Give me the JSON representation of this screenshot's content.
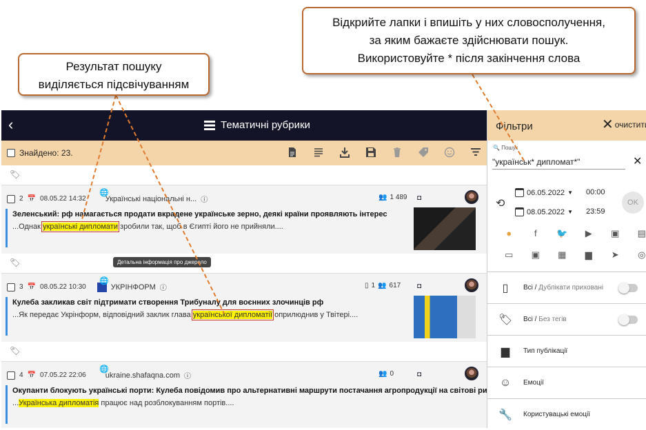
{
  "callouts": {
    "right": [
      "Відкрийте лапки і впишіть у них словосполучення,",
      "за яким бажаєте здійснювати пошук.",
      "Використовуйте * після закінчення слова"
    ],
    "left": [
      "Результат пошуку",
      "виділяється підсвічуванням"
    ]
  },
  "header": {
    "back_icon": "chevron-left-icon",
    "title": "Тематичні рубрики",
    "title_icon": "list-icon"
  },
  "toolbar": {
    "found": "Знайдено: 23.",
    "tools": [
      "document-icon",
      "lines-icon",
      "download-icon",
      "save-icon",
      "delete-icon",
      "tag-icon",
      "emoji-icon",
      "filter-icon"
    ]
  },
  "items": [
    {
      "num": "2",
      "date": "08.05.22 14:32",
      "source": "Українські національні н...",
      "stat_people": "1 489",
      "stat_dup": "",
      "headline": "Зеленський: рф намагається продати вкрадене українське зерно, деякі країни проявляють інтерес",
      "snip_pre": "...Однак ",
      "snip_hl": "українські дипломати",
      "snip_post": " зробили так, щоб в Єгипті його не прийняли....",
      "thumb": "zelensky"
    },
    {
      "num": "3",
      "date": "08.05.22 10:30",
      "source": "УКРІНФОРМ",
      "stat_people": "617",
      "stat_dup": "1",
      "headline": "Кулеба закликав світ підтримати створення Трибуналу для воєнних злочинців рф",
      "snip_pre": "...Як передає Укрінформ, відповідний заклик глава ",
      "snip_hl": "української дипломатії",
      "snip_post": " оприлюднив у Твітері....",
      "thumb": "kuleba"
    },
    {
      "num": "4",
      "date": "07.05.22 22:06",
      "source": "ukraine.shafaqna.com",
      "stat_people": "0",
      "stat_dup": "",
      "headline": "Окупанти блокують українські порти: Кулеба повідомив про альтернативні маршрути постачання агропродукції на світові ринки",
      "snip_pre": "...",
      "snip_hl": "Українська дипломатія",
      "snip_post": " працює над розблокуванням портів....",
      "thumb": ""
    }
  ],
  "tooltip": "Детальна інформація про джерело",
  "panel": {
    "title": "Фільтри",
    "clear": "очистити",
    "search_label": "Пошук",
    "search_value": "\"українськ* дипломат*\"",
    "date_from": "06.05.2022",
    "time_from": "00:00",
    "date_to": "08.05.2022",
    "time_to": "23:59",
    "ok": "OK",
    "rows": [
      {
        "icon": "duplicates-icon",
        "label": "Всі",
        "sub": "Дублікати приховані",
        "toggle": false
      },
      {
        "icon": "tag-icon",
        "label": "Всі",
        "sub": "Без тегів",
        "toggle": false
      },
      {
        "icon": "message-icon",
        "label": "Тип публікації",
        "sub": "",
        "toggle": null
      },
      {
        "icon": "emoji-icon",
        "label": "Емоції",
        "sub": "",
        "toggle": null
      },
      {
        "icon": "wrench-icon",
        "label": "Користувацькі емоції",
        "sub": "",
        "toggle": null
      }
    ]
  }
}
